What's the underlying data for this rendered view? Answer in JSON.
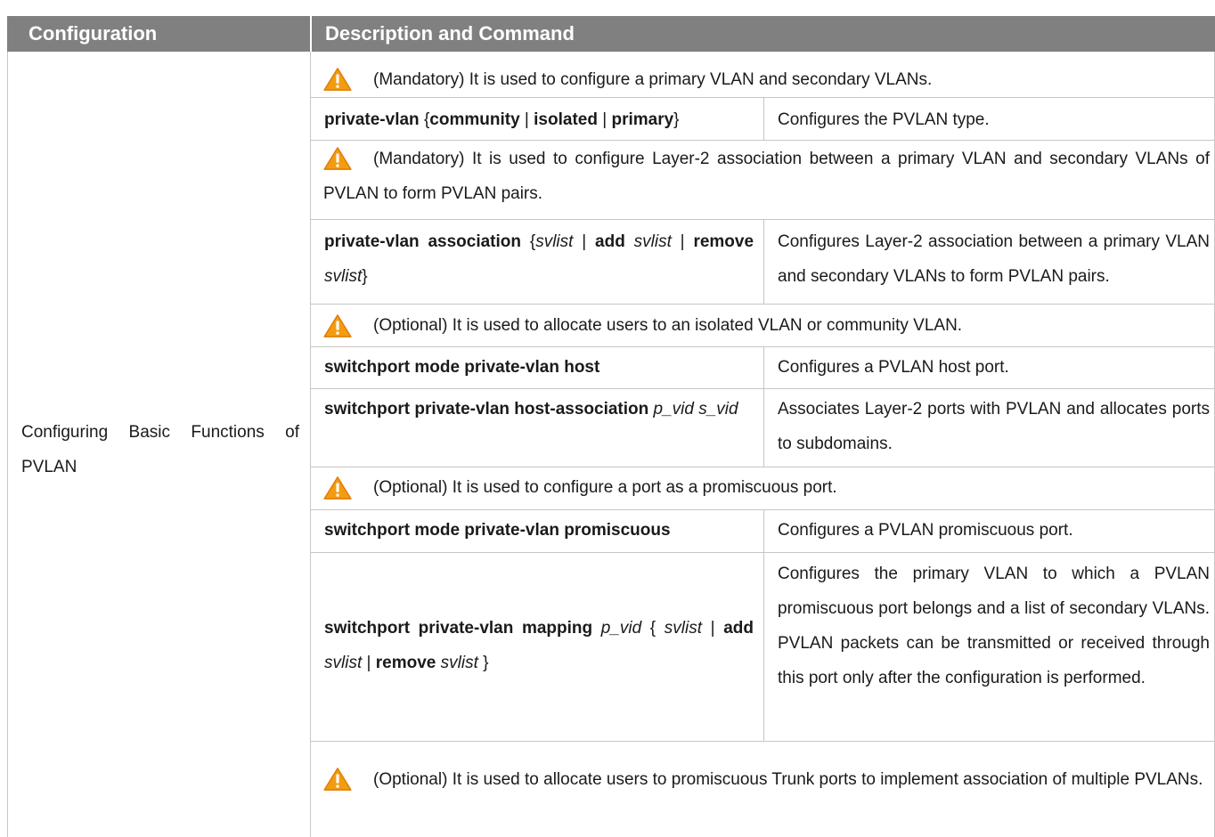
{
  "header": {
    "col_configuration": "Configuration",
    "col_description": "Description and Command"
  },
  "configuration_label": "Configuring Basic Functions of PVLAN",
  "rows": {
    "note1": "(Mandatory) It is used to configure a primary VLAN and secondary VLANs.",
    "cmd1": {
      "kw1": "private-vlan",
      "b_open": "{",
      "kw2": "community",
      "sep1": " | ",
      "kw3": "isolated",
      "sep2": " | ",
      "kw4": "primary",
      "b_close": "}",
      "desc": "Configures the PVLAN type."
    },
    "note2": "(Mandatory) It is used to configure Layer-2 association between a primary VLAN and secondary VLANs of PVLAN to form PVLAN pairs.",
    "cmd2": {
      "kw1": "private-vlan association",
      "b_open": "{",
      "arg1": "svlist",
      "sep1": " | ",
      "kw2": "add",
      "arg2": "svlist",
      "sep2": " | ",
      "kw3": "remove",
      "arg3": "svlist",
      "b_close": "}",
      "desc": "Configures Layer-2 association between a primary VLAN and secondary VLANs to form PVLAN pairs."
    },
    "note3": "(Optional) It is used to allocate users to an isolated VLAN or community VLAN.",
    "cmd3": {
      "kw1": "switchport mode private-vlan host",
      "desc": "Configures a PVLAN host port."
    },
    "cmd4": {
      "kw1": "switchport private-vlan host-association",
      "arg1": "p_vid",
      "arg2": "s_vid",
      "desc": "Associates Layer-2 ports with PVLAN and allocates ports to subdomains."
    },
    "note4": "(Optional) It is used to configure a port as a promiscuous port.",
    "cmd5": {
      "kw1": "switchport mode private-vlan promiscuous",
      "desc": "Configures a PVLAN promiscuous port."
    },
    "cmd6": {
      "kw1": "switchport private-vlan mapping",
      "arg1": "p_vid",
      "b_open": "{",
      "arg2": "svlist",
      "sep1": " |",
      "kw2": "add",
      "arg3": "svlist",
      "sep2": " | ",
      "kw3": "remove",
      "arg4": "svlist",
      "b_close": "}",
      "desc": "Configures the primary VLAN to which a PVLAN promiscuous port belongs and a list of secondary VLANs. PVLAN packets can be transmitted or received through this port only after the configuration is performed."
    },
    "note5": "(Optional) It is used to allocate users to promiscuous Trunk ports to implement association of multiple PVLANs."
  },
  "icons": {
    "warning": "warning-triangle-icon"
  },
  "colors": {
    "header_bg": "#808080",
    "warning_fill": "#f39c12",
    "grid": "#c6c6c6"
  }
}
